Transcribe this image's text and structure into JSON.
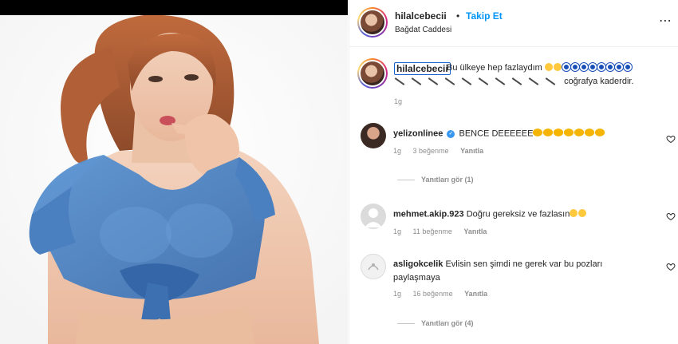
{
  "post": {
    "username": "hilalcebecii",
    "separator": "•",
    "follow_label": "Takip Et",
    "location": "Bağdat Caddesi",
    "more_icon": "more-horizontal-icon"
  },
  "caption": {
    "username": "hilalcebecii",
    "text": "Bu ülkeye hep fazlaydım",
    "line2_text": "coğrafya kaderdir.",
    "time": "1g"
  },
  "comments": [
    {
      "username": "yelizonlinee",
      "verified": true,
      "text": "BENCE DEEEEEE",
      "time": "1g",
      "likes": "3 beğenme",
      "reply": "Yanıtla",
      "view_replies": "Yanıtları gör (1)"
    },
    {
      "username": "mehmet.akip.923",
      "verified": false,
      "text": "Doğru gereksiz ve fazlasın",
      "time": "1g",
      "likes": "11 beğenme",
      "reply": "Yanıtla"
    },
    {
      "username": "asligokcelik",
      "verified": false,
      "text": "Evlisin sen şimdi ne gerek var bu pozları paylaşmaya",
      "time": "1g",
      "likes": "16 beğenme",
      "reply": "Yanıtla",
      "view_replies": "Yanıtları gör (4)"
    }
  ],
  "colors": {
    "follow": "#0095f6",
    "verified": "#3897f0",
    "muted": "#8e8e8e",
    "shirt": "#4f86c6"
  }
}
